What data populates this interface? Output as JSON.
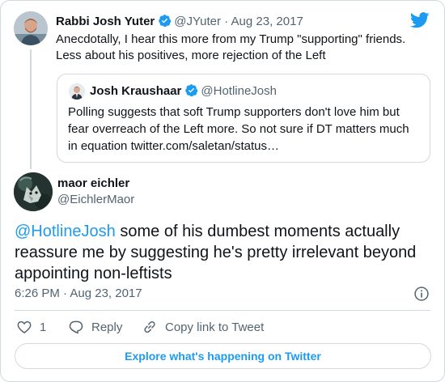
{
  "parent": {
    "name": "Rabbi Josh Yuter",
    "handle": "@JYuter",
    "separator": "·",
    "date": "Aug 23, 2017",
    "text": "Anecdotally, I hear this more from my Trump \"supporting\" friends. Less about his positives, more rejection of the Left",
    "avatar_icon": "person-photo-avatar",
    "verified_icon": "verified-badge-icon"
  },
  "quote": {
    "name": "Josh Kraushaar",
    "handle": "@HotlineJosh",
    "text": "Polling suggests that soft Trump supporters don't love him but fear overreach of the Left more.  So not sure if DT matters much in equation twitter.com/saletan/status…",
    "avatar_icon": "person-photo-avatar",
    "verified_icon": "verified-badge-icon"
  },
  "main": {
    "name": "maor eichler",
    "handle": "@EichlerMaor",
    "mention": "@HotlineJosh",
    "text": " some of his dumbest moments actually reassure me by suggesting he's pretty irrelevant beyond appointing non-leftists",
    "timestamp": "6:26 PM · Aug 23, 2017",
    "avatar_icon": "wolf-photo-avatar"
  },
  "actions": {
    "like_count": "1",
    "reply_label": "Reply",
    "copy_label": "Copy link to Tweet"
  },
  "explore_label": "Explore what's happening on Twitter",
  "colors": {
    "accent": "#1d9bf0",
    "text": "#0f1419",
    "secondary": "#536471",
    "border": "#cfd9de"
  }
}
